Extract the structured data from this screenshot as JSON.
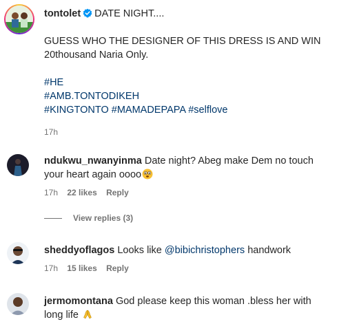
{
  "post": {
    "username": "tontolet",
    "title": "DATE NIGHT....",
    "body_line1": "GUESS WHO THE DESIGNER OF THIS DRESS IS AND WIN",
    "body_line2": "20thousand Naria Only.",
    "tags": [
      "#HE",
      "#AMB.TONTODIKEH",
      "#KINGTONTO #MAMADEPAPA #selflove"
    ],
    "time": "17h"
  },
  "comments": [
    {
      "username": "ndukwu_nwanyinma",
      "text_line1": "Date night? Abeg make Dem no touch",
      "text_line2": "your heart again oooo",
      "time": "17h",
      "likes": "22 likes",
      "reply": "Reply"
    },
    {
      "username": "sheddyoflagos",
      "text_before": "Looks like",
      "mention": "@bibichristophers",
      "text_after": "handwork",
      "time": "17h",
      "likes": "15 likes",
      "reply": "Reply"
    },
    {
      "username": "jermomontana",
      "text_line1": "God please keep this woman .bless her with",
      "text_line2": "long life"
    }
  ],
  "view_replies": "View replies (3)",
  "icons": {
    "verified": "verified-badge-icon",
    "emoji_face": "face-with-eyes-emoji-icon",
    "emoji_pray": "folded-hands-emoji-icon"
  },
  "colors": {
    "link": "#00376b",
    "muted": "#737373",
    "verified": "#0095f6"
  }
}
